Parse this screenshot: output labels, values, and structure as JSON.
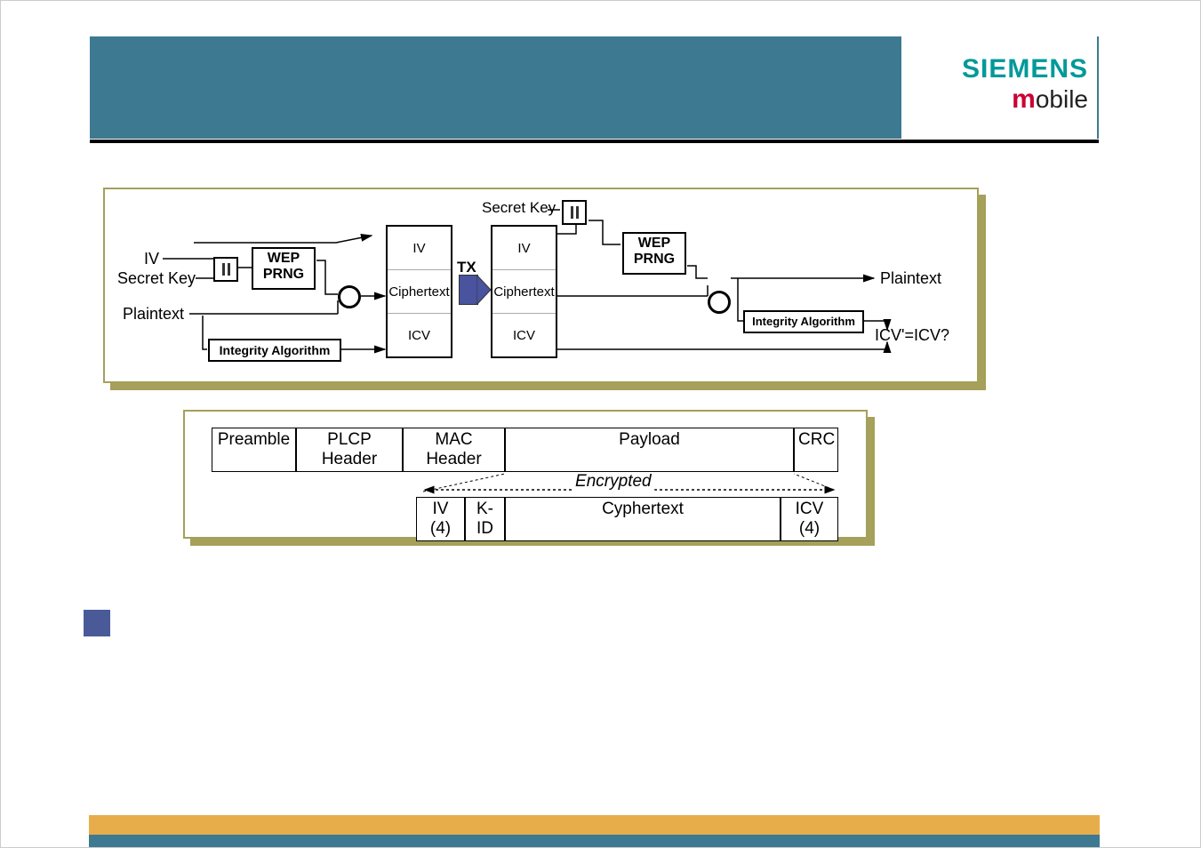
{
  "logo": {
    "brand": "SIEMENS",
    "m": "m",
    "obile": "obile"
  },
  "diagram": {
    "iv_left": "IV",
    "secret_key_left": "Secret Key",
    "plaintext_left": "Plaintext",
    "wep_prng_left": "WEP\nPRNG",
    "integrity_left": "Integrity Algorithm",
    "col_iv": "IV",
    "col_cipher": "Ciphertext",
    "col_icv": "ICV",
    "tx": "TX",
    "secret_key_right": "Secret Key",
    "wep_prng_right": "WEP\nPRNG",
    "integrity_right": "Integrity Algorithm",
    "plaintext_right": "Plaintext",
    "icv_eq": "ICV'=ICV?"
  },
  "frame": {
    "preamble": "Preamble",
    "plcp": "PLCP Header",
    "mac": "MAC Header",
    "payload": "Payload",
    "crc": "CRC",
    "encrypted": "Encrypted",
    "iv4": "IV (4)",
    "kid": "K-ID",
    "cyphertext": "Cyphertext",
    "icv4": "ICV (4)"
  }
}
